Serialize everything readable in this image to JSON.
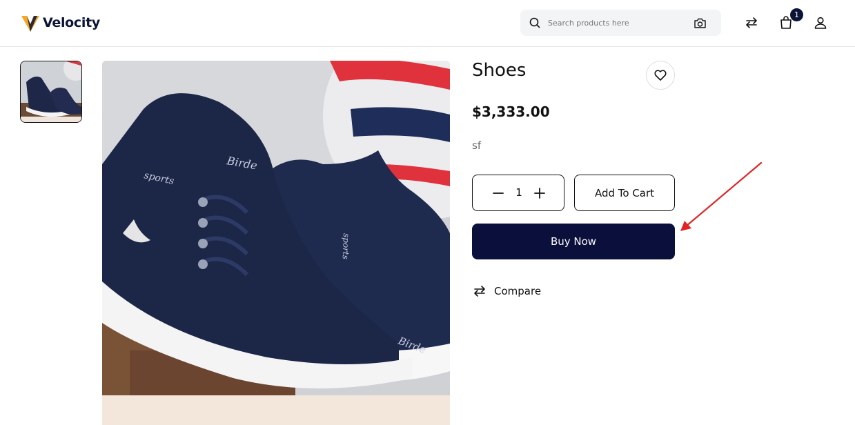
{
  "header": {
    "brand": "Velocity",
    "search_placeholder": "Search products here",
    "cart_count": "1"
  },
  "product": {
    "title": "Shoes",
    "price": "$3,333.00",
    "description": "sf",
    "quantity": "1",
    "add_to_cart_label": "Add To Cart",
    "buy_now_label": "Buy Now",
    "compare_label": "Compare"
  },
  "icons": {
    "logo": "v-logo-icon",
    "search": "search-icon",
    "camera": "camera-icon",
    "compare_header": "swap-arrows-icon",
    "cart": "shopping-bag-icon",
    "account": "user-icon",
    "wishlist": "heart-icon",
    "minus": "minus-icon",
    "plus": "plus-icon",
    "compare": "swap-arrows-icon"
  },
  "colors": {
    "brand_navy": "#0a0f3c",
    "logo_orange": "#f5a623",
    "annotation_red": "#e02424"
  }
}
